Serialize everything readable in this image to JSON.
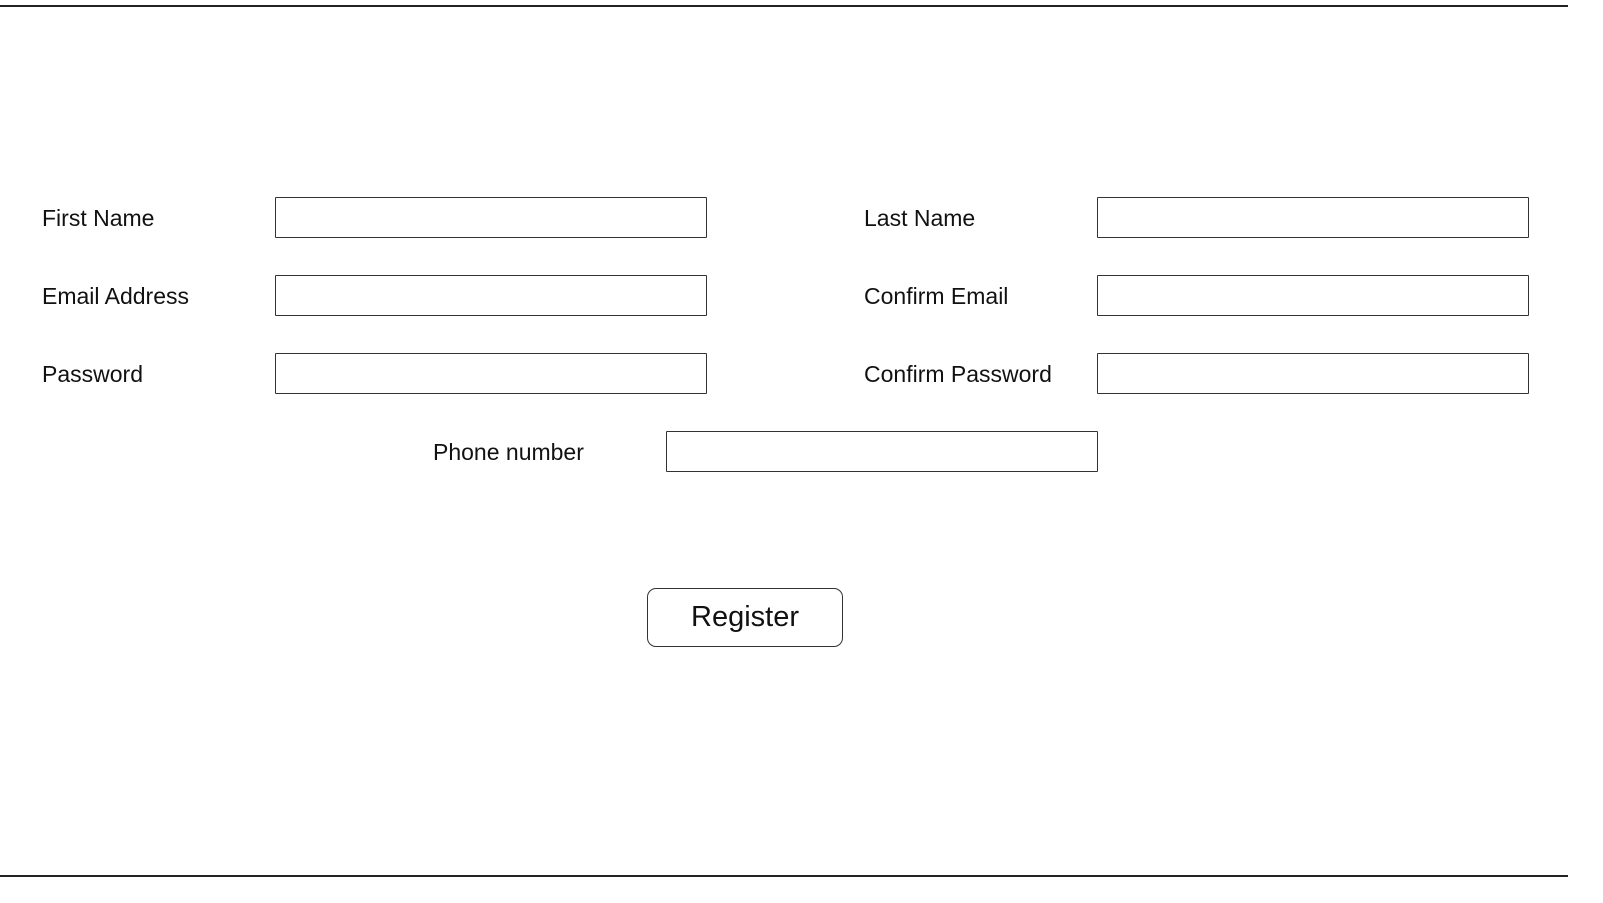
{
  "form": {
    "first_name": {
      "label": "First Name",
      "value": "",
      "placeholder": ""
    },
    "last_name": {
      "label": "Last Name",
      "value": "",
      "placeholder": ""
    },
    "email": {
      "label": "Email Address",
      "value": "",
      "placeholder": ""
    },
    "confirm_email": {
      "label": "Confirm Email",
      "value": "",
      "placeholder": ""
    },
    "password": {
      "label": "Password",
      "value": "",
      "placeholder": ""
    },
    "confirm_password": {
      "label": "Confirm Password",
      "value": "",
      "placeholder": ""
    },
    "phone": {
      "label": "Phone number",
      "value": "",
      "placeholder": ""
    },
    "register_label": "Register"
  }
}
